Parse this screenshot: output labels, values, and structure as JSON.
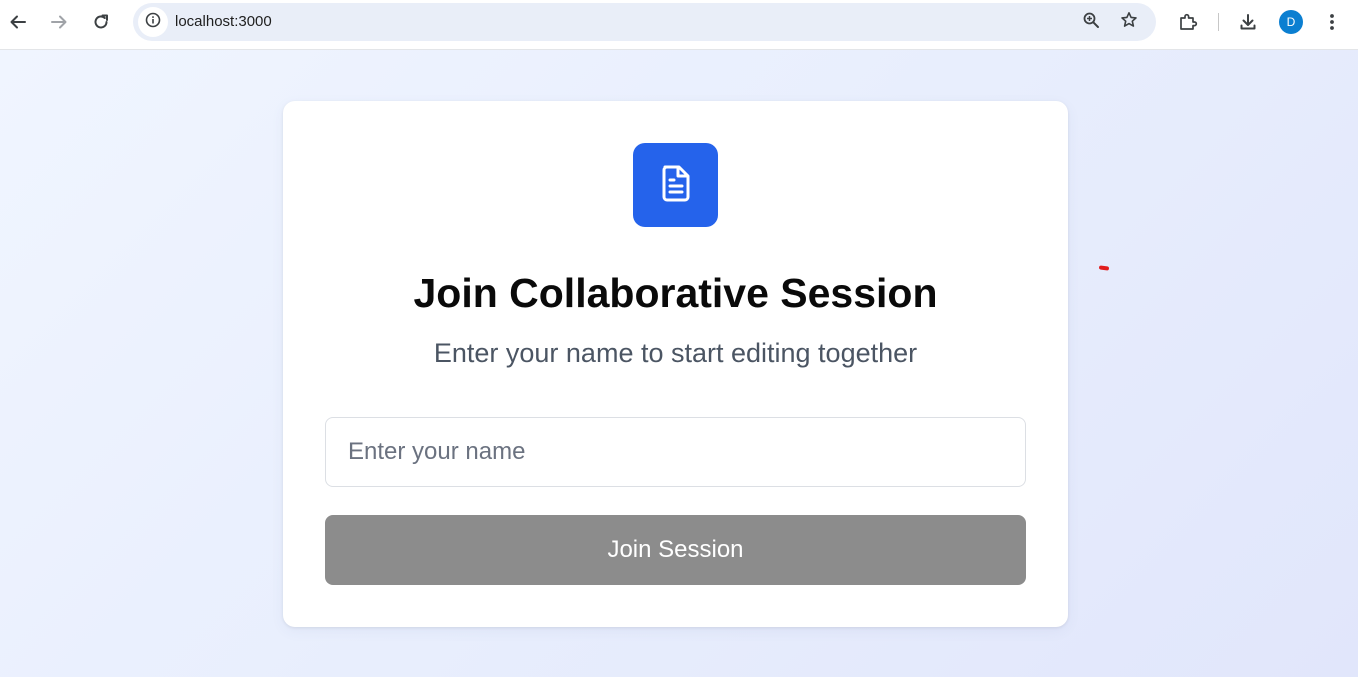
{
  "browser": {
    "url": "localhost:3000",
    "profile_initial": "D",
    "icons": {
      "back": "back-arrow-icon",
      "forward": "forward-arrow-icon",
      "reload": "reload-icon",
      "site_info": "info-icon",
      "zoom": "zoom-icon",
      "bookmark": "star-icon",
      "extensions": "puzzle-icon",
      "downloads": "download-icon",
      "menu": "kebab-menu-icon"
    }
  },
  "card": {
    "logo_icon": "document-icon",
    "title": "Join Collaborative Session",
    "subtitle": "Enter your name to start editing together",
    "name_input": {
      "value": "",
      "placeholder": "Enter your name"
    },
    "join_button_label": "Join Session"
  },
  "colors": {
    "accent": "#2563eb",
    "button_disabled": "#8c8c8c",
    "avatar": "#0b7fd1"
  }
}
